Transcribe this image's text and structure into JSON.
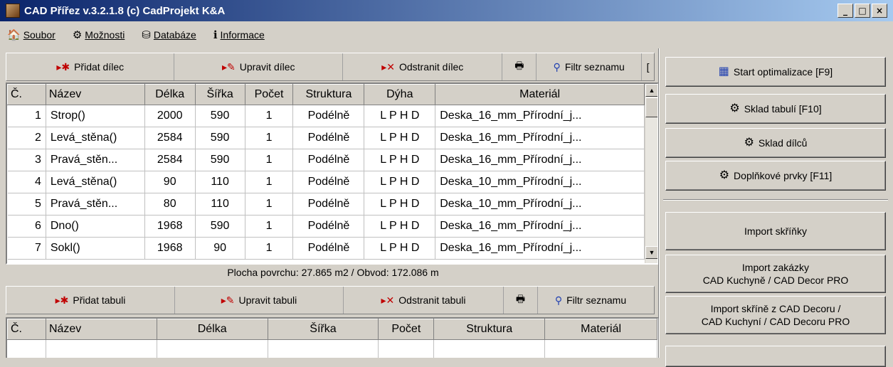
{
  "window": {
    "title": "CAD Přířez v.3.2.1.8  (c) CadProjekt K&A",
    "min_label": "_",
    "max_label": "□",
    "close_label": "×"
  },
  "menu": [
    {
      "label": "Soubor",
      "icon": "home-icon"
    },
    {
      "label": "Možnosti",
      "icon": "settings-icon"
    },
    {
      "label": "Databáze",
      "icon": "database-icon"
    },
    {
      "label": "Informace",
      "icon": "info-icon"
    }
  ],
  "parts_toolbar": {
    "add": "Přidat dílec",
    "edit": "Upravit dílec",
    "delete": "Odstranit dílec",
    "filter": "Filtr seznamu"
  },
  "parts_table": {
    "headers": [
      "Č.",
      "Název",
      "Délka",
      "Šířka",
      "Počet",
      "Struktura",
      "Dýha",
      "Materiál"
    ],
    "rows": [
      [
        "1",
        "Strop()",
        "2000",
        "590",
        "1",
        "Podélně",
        "L P H D",
        "Deska_16_mm_Přírodní_j..."
      ],
      [
        "2",
        "Levá_stěna()",
        "2584",
        "590",
        "1",
        "Podélně",
        "L P H D",
        "Deska_16_mm_Přírodní_j..."
      ],
      [
        "3",
        "Pravá_stěn...",
        "2584",
        "590",
        "1",
        "Podélně",
        "L P H D",
        "Deska_16_mm_Přírodní_j..."
      ],
      [
        "4",
        "Levá_stěna()",
        "90",
        "110",
        "1",
        "Podélně",
        "L P H D",
        "Deska_10_mm_Přírodní_j..."
      ],
      [
        "5",
        "Pravá_stěn...",
        "80",
        "110",
        "1",
        "Podélně",
        "L P H D",
        "Deska_10_mm_Přírodní_j..."
      ],
      [
        "6",
        "Dno()",
        "1968",
        "590",
        "1",
        "Podélně",
        "L P H D",
        "Deska_16_mm_Přírodní_j..."
      ],
      [
        "7",
        "Sokl()",
        "1968",
        "90",
        "1",
        "Podélně",
        "L P H D",
        "Deska_16_mm_Přírodní_j..."
      ]
    ]
  },
  "status_text": "Plocha povrchu: 27.865 m2 / Obvod: 172.086 m",
  "boards_toolbar": {
    "add": "Přidat tabuli",
    "edit": "Upravit tabuli",
    "delete": "Odstranit tabuli",
    "filter": "Filtr seznamu"
  },
  "boards_table": {
    "headers": [
      "Č.",
      "Název",
      "Délka",
      "Šířka",
      "Počet",
      "Struktura",
      "Materiál"
    ]
  },
  "right_panel": {
    "start": "Start optimalizace [F9]",
    "sheet_stock": "Sklad tabulí [F10]",
    "part_stock": "Sklad dílců",
    "extras": "Doplňkové prvky [F11]",
    "import_cabinet": "Import skříňky",
    "import_order_line1": "Import zakázky",
    "import_order_line2": "CAD Kuchyně / CAD Decor PRO",
    "import_decor_line1": "Import skříně z CAD Decoru /",
    "import_decor_line2": "CAD Kuchyní / CAD Decoru PRO"
  }
}
